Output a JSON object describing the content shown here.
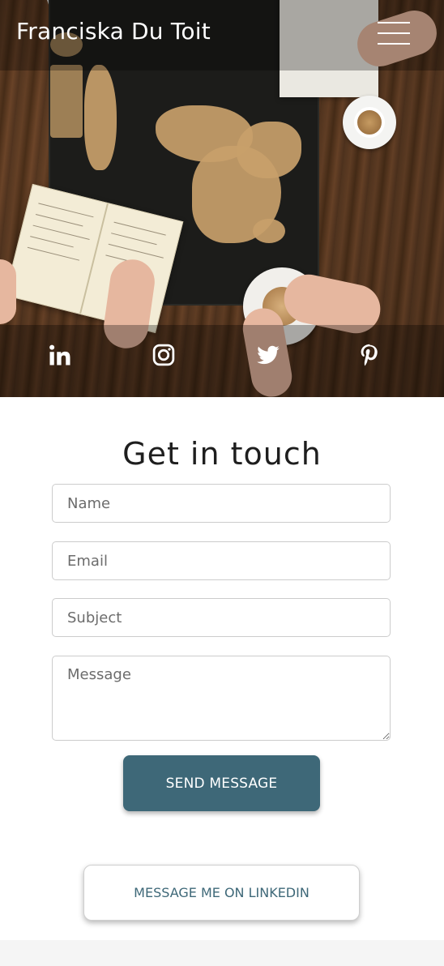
{
  "header": {
    "title": "Franciska Du Toit",
    "menu_icon": "hamburger-menu-icon"
  },
  "social": [
    {
      "name": "linkedin",
      "icon": "linkedin-icon"
    },
    {
      "name": "instagram",
      "icon": "instagram-icon"
    },
    {
      "name": "twitter",
      "icon": "twitter-icon"
    },
    {
      "name": "pinterest",
      "icon": "pinterest-icon"
    }
  ],
  "contact": {
    "heading": "Get in touch",
    "name_placeholder": "Name",
    "email_placeholder": "Email",
    "subject_placeholder": "Subject",
    "message_placeholder": "Message",
    "send_label": "SEND MESSAGE",
    "linkedin_label": "MESSAGE ME ON LINKEDIN"
  },
  "colors": {
    "accent": "#3e6878",
    "text_dark": "#1e1e1e",
    "white": "#ffffff"
  }
}
